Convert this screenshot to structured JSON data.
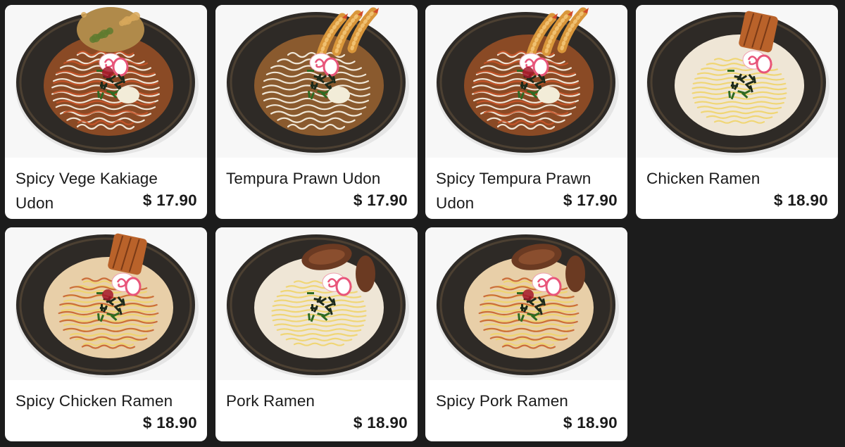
{
  "menu": {
    "items": [
      {
        "name": "Spicy Vege Kakiage Udon",
        "price": "$ 17.90",
        "image": "spicy-vege-kakiage-udon-photo",
        "noodle": "udon",
        "spicy": true,
        "topping": "kakiage"
      },
      {
        "name": "Tempura Prawn Udon",
        "price": "$ 17.90",
        "image": "tempura-prawn-udon-photo",
        "noodle": "udon",
        "spicy": false,
        "topping": "prawn"
      },
      {
        "name": "Spicy Tempura Prawn Udon",
        "price": "$ 17.90",
        "image": "spicy-tempura-prawn-udon-photo",
        "noodle": "udon",
        "spicy": true,
        "topping": "prawn"
      },
      {
        "name": "Chicken Ramen",
        "price": "$ 18.90",
        "image": "chicken-ramen-photo",
        "noodle": "ramen",
        "spicy": false,
        "topping": "chicken"
      },
      {
        "name": "Spicy Chicken Ramen",
        "price": "$ 18.90",
        "image": "spicy-chicken-ramen-photo",
        "noodle": "ramen",
        "spicy": true,
        "topping": "chicken"
      },
      {
        "name": "Pork Ramen",
        "price": "$ 18.90",
        "image": "pork-ramen-photo",
        "noodle": "ramen",
        "spicy": false,
        "topping": "pork"
      },
      {
        "name": "Spicy Pork Ramen",
        "price": "$ 18.90",
        "image": "spicy-pork-ramen-photo",
        "noodle": "ramen",
        "spicy": true,
        "topping": "pork"
      }
    ]
  },
  "colors": {
    "page_background": "#1c1c1c",
    "card_background": "#ffffff",
    "text": "#1a1a1a",
    "bowl": "#2e2a26"
  }
}
